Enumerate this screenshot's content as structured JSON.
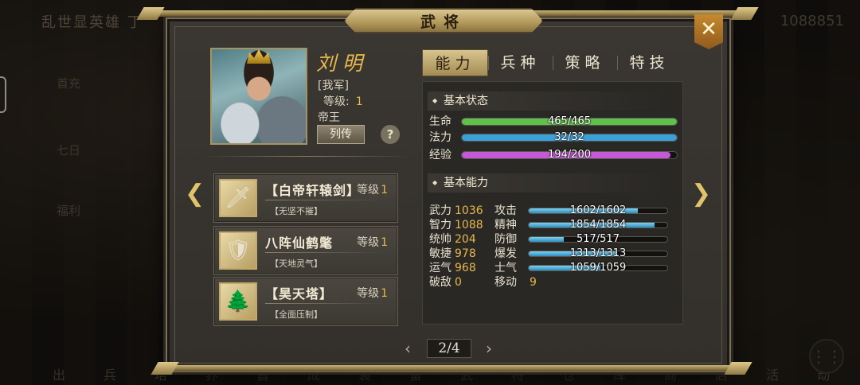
{
  "background": {
    "title": "乱世显英雄 丁",
    "gold": "1088851",
    "side_items": [
      "首充",
      "七日",
      "福利"
    ],
    "bottom_items": [
      "出兵",
      "培养",
      "首成",
      "装备",
      "武将",
      "仓库",
      "商店",
      "活动"
    ]
  },
  "dialog": {
    "title": "武将",
    "close_label": "✕"
  },
  "hero": {
    "name": "刘明",
    "faction": "[我军]",
    "level_label": "等级:",
    "level": "1",
    "title": "帝王",
    "bio_button": "列传",
    "help_button": "?"
  },
  "equipment": [
    {
      "name": "【白帝轩辕剑】",
      "level_label": "等级",
      "level": "1",
      "tag": "【无坚不摧】",
      "icon": "sword-icon",
      "glyph": "🗡"
    },
    {
      "name": "八阵仙鹤氅",
      "level_label": "等级",
      "level": "1",
      "tag": "【天地灵气】",
      "icon": "armor-icon",
      "glyph": "🛡"
    },
    {
      "name": "【昊天塔】",
      "level_label": "等级",
      "level": "1",
      "tag": "【全面压制】",
      "icon": "tower-icon",
      "glyph": "🌲"
    }
  ],
  "tabs": [
    "能力",
    "兵种",
    "策略",
    "特技"
  ],
  "active_tab": 0,
  "basic_status": {
    "header": "基本状态",
    "rows": [
      {
        "label": "生命",
        "text": "465/465",
        "fill": 1.0,
        "color": "#5fc24a"
      },
      {
        "label": "法力",
        "text": "32/32",
        "fill": 1.0,
        "color": "#3aa0d8"
      },
      {
        "label": "经验",
        "text": "194/200",
        "fill": 0.97,
        "color": "#c45ad8"
      }
    ]
  },
  "basic_ability": {
    "header": "基本能力",
    "attributes": [
      {
        "label": "武力",
        "value": "1036"
      },
      {
        "label": "智力",
        "value": "1088"
      },
      {
        "label": "统帅",
        "value": "204"
      },
      {
        "label": "敏捷",
        "value": "978"
      },
      {
        "label": "运气",
        "value": "968"
      },
      {
        "label": "破敌",
        "value": "0"
      }
    ],
    "combat": [
      {
        "label": "攻击",
        "text": "1602/1602",
        "fill": 0.79
      },
      {
        "label": "精神",
        "text": "1854/1854",
        "fill": 0.91
      },
      {
        "label": "防御",
        "text": "517/517",
        "fill": 0.25
      },
      {
        "label": "爆发",
        "text": "1313/1313",
        "fill": 0.64
      },
      {
        "label": "士气",
        "text": "1059/1059",
        "fill": 0.52
      }
    ],
    "move_label": "移动",
    "move_value": "9"
  },
  "pager": {
    "prev": "‹",
    "next": "›",
    "text": "2/4"
  },
  "nav": {
    "left": "❮",
    "right": "❯"
  }
}
